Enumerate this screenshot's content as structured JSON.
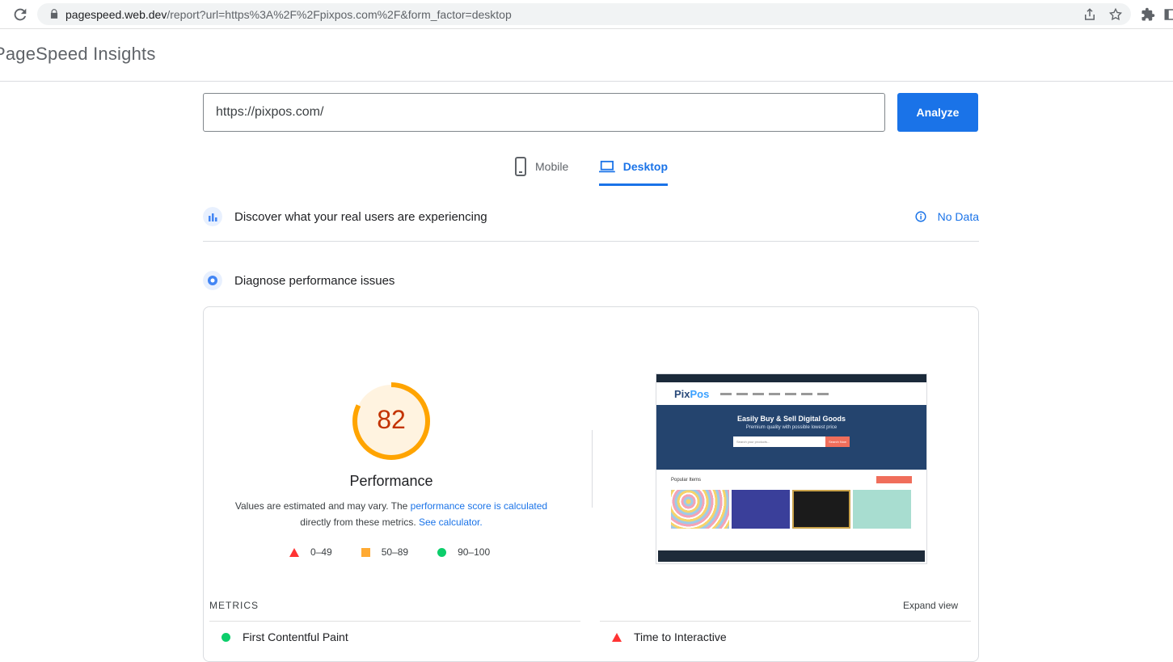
{
  "browser": {
    "url_host": "pagespeed.web.dev",
    "url_path": "/report?url=https%3A%2F%2Fpixpos.com%2F&form_factor=desktop"
  },
  "app": {
    "title": "PageSpeed Insights"
  },
  "search": {
    "value": "https://pixpos.com/",
    "analyze_label": "Analyze"
  },
  "tabs": [
    {
      "label": "Mobile",
      "active": false
    },
    {
      "label": "Desktop",
      "active": true
    }
  ],
  "real_users": {
    "title": "Discover what your real users are experiencing",
    "status": "No Data"
  },
  "diagnose": {
    "title": "Diagnose performance issues"
  },
  "performance": {
    "score": "82",
    "score_fraction": 0.82,
    "label": "Performance",
    "desc_1": "Values are estimated and may vary. The ",
    "desc_link_1": "performance score is calculated",
    "desc_2": "directly from these metrics. ",
    "desc_link_2": "See calculator."
  },
  "legend": [
    {
      "range": "0–49",
      "shape": "triangle",
      "color": "#ff3333"
    },
    {
      "range": "50–89",
      "shape": "square",
      "color": "#ffaa33"
    },
    {
      "range": "90–100",
      "shape": "circle",
      "color": "#0cce6b"
    }
  ],
  "screenshot": {
    "logo_1": "Pix",
    "logo_2": "Pos",
    "hero_title": "Easily Buy & Sell Digital Goods",
    "hero_sub": "Premium quality with possible lowest price",
    "search_placeholder": "Search your products...",
    "search_btn": "Search Now",
    "popular": "Popular Items"
  },
  "metrics": {
    "heading": "METRICS",
    "expand": "Expand view",
    "items": [
      {
        "name": "First Contentful Paint",
        "status": "good"
      },
      {
        "name": "Time to Interactive",
        "status": "poor"
      }
    ]
  },
  "colors": {
    "accent": "#1a73e8",
    "score_average": "#ffa400",
    "score_text": "#c33300"
  }
}
